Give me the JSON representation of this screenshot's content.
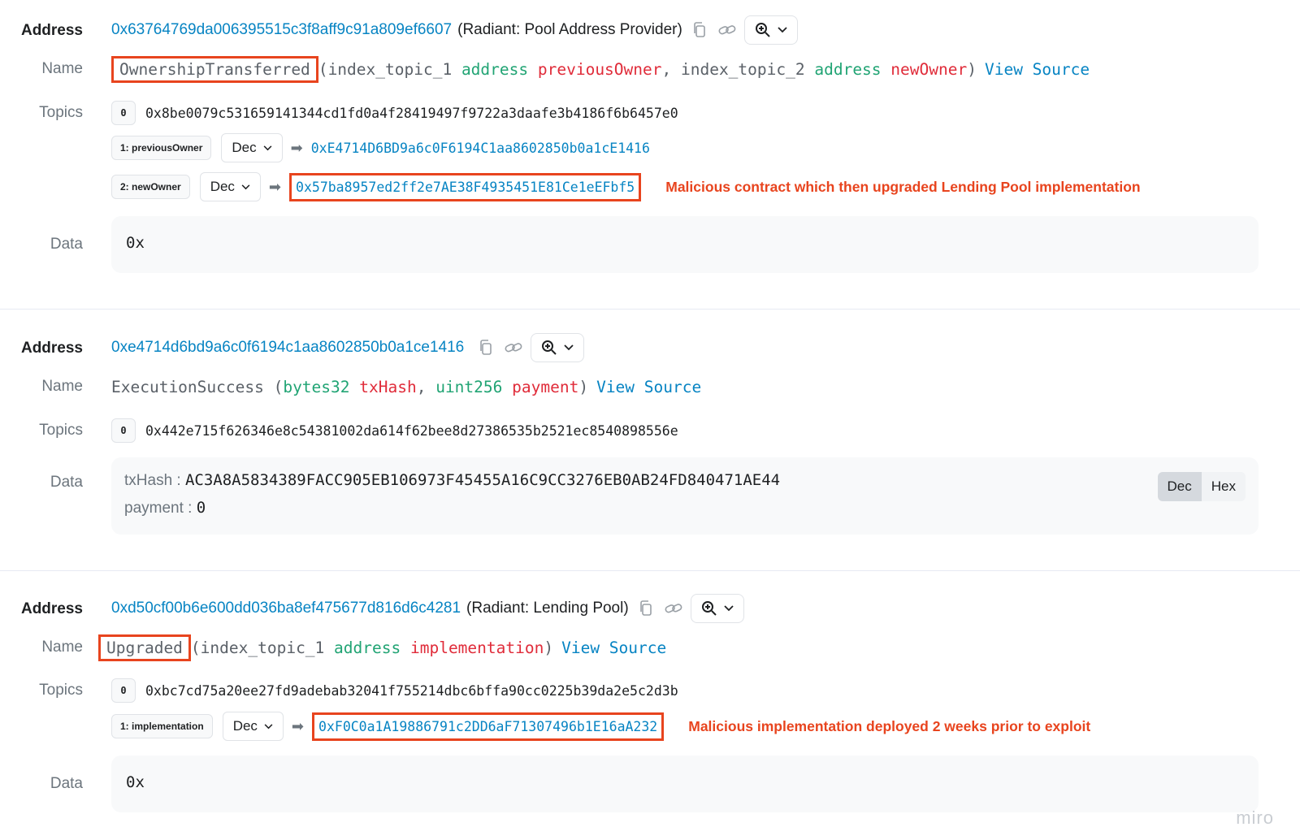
{
  "labels": {
    "address": "Address",
    "name": "Name",
    "topics": "Topics",
    "data": "Data"
  },
  "common": {
    "view_source": "View Source",
    "dec": "Dec",
    "hex": "Hex",
    "arrow": "➡",
    "topic_zero_badge": "0"
  },
  "logs": [
    {
      "address": "0x63764769da006395515c3f8aff9c91a809ef6607",
      "address_tag": "(Radiant: Pool Address Provider)",
      "event_name": "OwnershipTransferred",
      "params_text": {
        "open": "(",
        "p1_prefix": "index_topic_1 ",
        "p1_type": "address",
        "p1_name": "previousOwner",
        "sep": ", ",
        "p2_prefix": "index_topic_2 ",
        "p2_type": "address",
        "p2_name": "newOwner",
        "close": ")"
      },
      "topic0": "0x8be0079c531659141344cd1fd0a4f28419497f9722a3daafe3b4186f6b6457e0",
      "topics": [
        {
          "badge": "1: previousOwner",
          "format": "Dec",
          "value": "0xE4714D6BD9a6c0F6194C1aa8602850b0a1cE1416"
        },
        {
          "badge": "2: newOwner",
          "format": "Dec",
          "value": "0x57ba8957ed2ff2e7AE38F4935451E81Ce1eEFbf5",
          "note": "Malicious contract which then upgraded Lending Pool implementation"
        }
      ],
      "data": "0x"
    },
    {
      "address": "0xe4714d6bd9a6c0f6194c1aa8602850b0a1ce1416",
      "event_name": "ExecutionSuccess",
      "params_text": {
        "open": " (",
        "p1_type": "bytes32",
        "p1_name": "txHash",
        "sep": ", ",
        "p2_type": "uint256",
        "p2_name": "payment",
        "close": ")"
      },
      "topic0": "0x442e715f626346e8c54381002da614f62bee8d27386535b2521ec8540898556e",
      "data_kv": [
        {
          "key": "txHash : ",
          "value": "AC3A8A5834389FACC905EB106973F45455A16C9CC3276EB0AB24FD840471AE44"
        },
        {
          "key": "payment : ",
          "value": "0"
        }
      ]
    },
    {
      "address": "0xd50cf00b6e600dd036ba8ef475677d816d6c4281",
      "address_tag": "(Radiant: Lending Pool)",
      "event_name": "Upgraded",
      "params_text": {
        "open": "(",
        "p1_prefix": "index_topic_1 ",
        "p1_type": "address",
        "p1_name": "implementation",
        "close": ")"
      },
      "topic0": "0xbc7cd75a20ee27fd9adebab32041f755214dbc6bffa90cc0225b39da2e5c2d3b",
      "topics": [
        {
          "badge": "1: implementation",
          "format": "Dec",
          "value": "0xF0C0a1A19886791c2DD6aF71307496b1E16aA232",
          "note": "Malicious implementation deployed 2 weeks prior to exploit"
        }
      ],
      "data": "0x"
    }
  ],
  "watermark": "miro",
  "colors": {
    "link": "#0784c3",
    "type": "#21a474",
    "param": "#e02c3a",
    "highlight": "#e8441e"
  }
}
